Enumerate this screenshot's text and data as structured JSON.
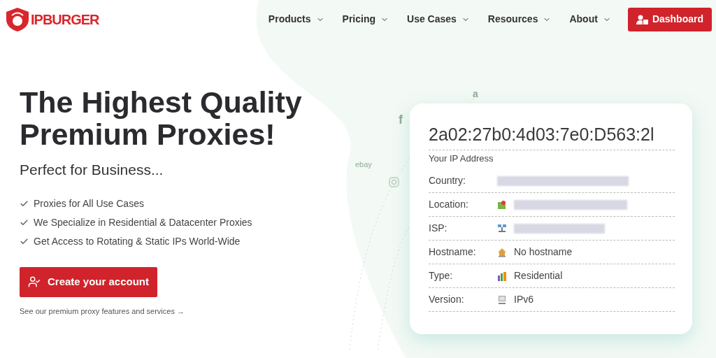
{
  "logo": {
    "text": "IPBURGER"
  },
  "nav": [
    {
      "label": "Products"
    },
    {
      "label": "Pricing"
    },
    {
      "label": "Use Cases"
    },
    {
      "label": "Resources"
    },
    {
      "label": "About"
    }
  ],
  "dashboard_button": "Dashboard",
  "hero": {
    "title": "The Highest Quality Premium Proxies!",
    "subtitle": "Perfect for Business...",
    "features": [
      "Proxies for All Use Cases",
      "We Specialize in Residential & Datacenter Proxies",
      "Get Access to Rotating & Static IPs World-Wide"
    ],
    "cta": "Create your account",
    "link": "See our premium proxy features and services →"
  },
  "background_logos": [
    "a",
    "f",
    "ebay"
  ],
  "ip_card": {
    "ip": "2a02:27b0:4d03:7e0:D563:2l",
    "caption": "Your IP Address",
    "rows": [
      {
        "label": "Country:",
        "kind": "blurred"
      },
      {
        "label": "Location:",
        "kind": "blurred"
      },
      {
        "label": "ISP:",
        "kind": "blurred"
      },
      {
        "label": "Hostname:",
        "kind": "text",
        "value": "No hostname"
      },
      {
        "label": "Type:",
        "kind": "text",
        "value": "Residential"
      },
      {
        "label": "Version:",
        "kind": "text",
        "value": "IPv6"
      }
    ]
  }
}
